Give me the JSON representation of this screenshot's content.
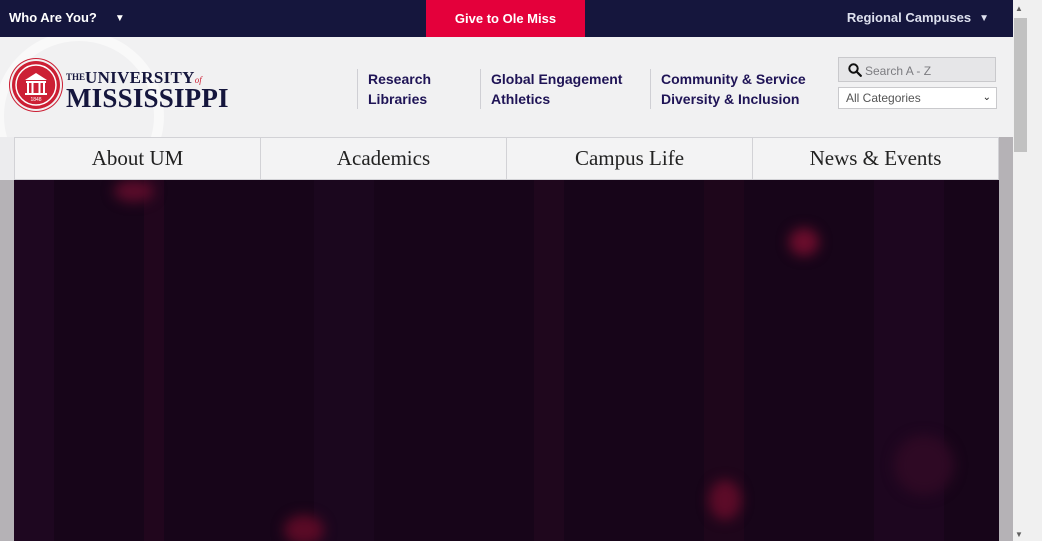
{
  "topbar": {
    "who_label": "Who Are You?",
    "give_label": "Give to Ole Miss",
    "regional_label": "Regional Campuses"
  },
  "logo": {
    "the": "THE",
    "university": "UNIVERSITY",
    "of": "of",
    "mississippi": "MISSISSIPPI",
    "seal_year": "1848"
  },
  "quicklinks": [
    [
      "Research",
      "Libraries"
    ],
    [
      "Global Engagement",
      "Athletics"
    ],
    [
      "Community & Service",
      "Diversity & Inclusion"
    ]
  ],
  "search": {
    "placeholder": "Search A - Z",
    "category": "All Categories"
  },
  "mainnav": [
    "About UM",
    "Academics",
    "Campus Life",
    "News & Events"
  ],
  "colors": {
    "navy": "#15163d",
    "red": "#e4003b",
    "link": "#1f1456"
  }
}
